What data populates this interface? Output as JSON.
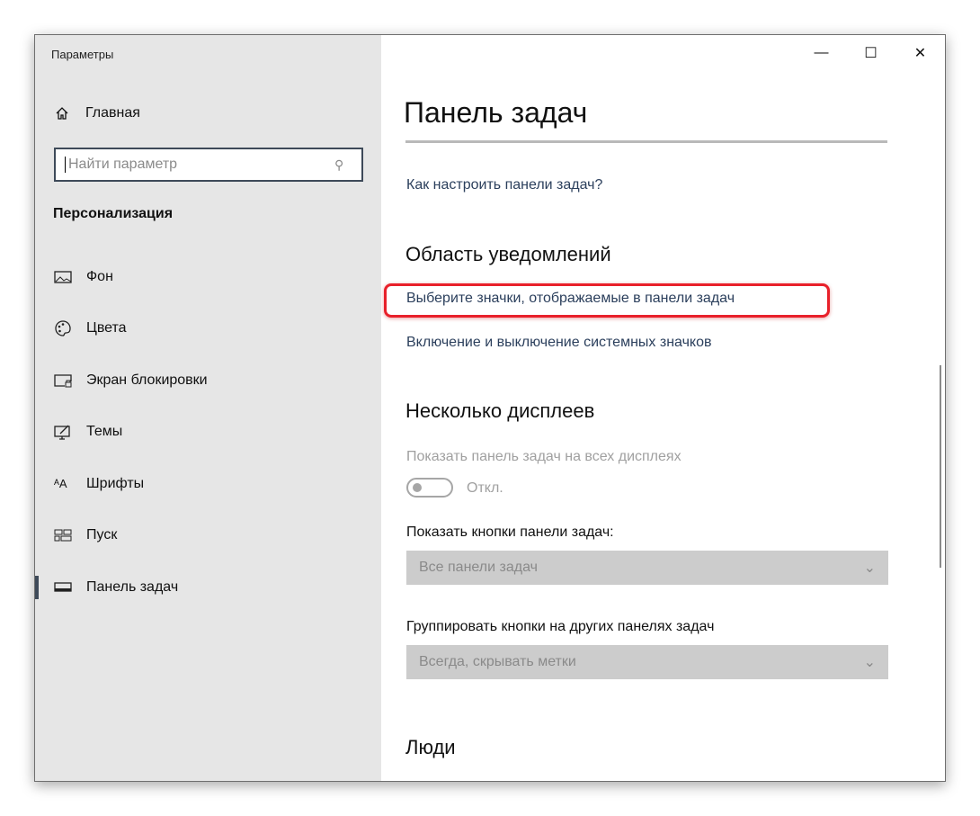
{
  "window": {
    "title": "Параметры"
  },
  "sidebar": {
    "home": "Главная",
    "search_placeholder": "Найти параметр",
    "section": "Персонализация",
    "items": [
      {
        "label": "Фон",
        "icon": "image-icon"
      },
      {
        "label": "Цвета",
        "icon": "palette-icon"
      },
      {
        "label": "Экран блокировки",
        "icon": "lock-screen-icon"
      },
      {
        "label": "Темы",
        "icon": "themes-icon"
      },
      {
        "label": "Шрифты",
        "icon": "fonts-icon"
      },
      {
        "label": "Пуск",
        "icon": "start-icon"
      },
      {
        "label": "Панель задач",
        "icon": "taskbar-icon",
        "active": true
      }
    ]
  },
  "main": {
    "title": "Панель задач",
    "help_link": "Как настроить панели задач?",
    "notif_heading": "Область уведомлений",
    "notif_link1": "Выберите значки, отображаемые в панели задач",
    "notif_link2": "Включение и выключение системных значков",
    "multi_heading": "Несколько дисплеев",
    "show_all_label": "Показать панель задач на всех дисплеях",
    "toggle_state": "Откл.",
    "buttons_label": "Показать кнопки панели задач:",
    "buttons_value": "Все панели задач",
    "group_label": "Группировать кнопки на других панелях задач",
    "group_value": "Всегда, скрывать метки",
    "people_heading": "Люди"
  },
  "colors": {
    "highlight": "#e8202a",
    "link": "#2b3f5c"
  }
}
